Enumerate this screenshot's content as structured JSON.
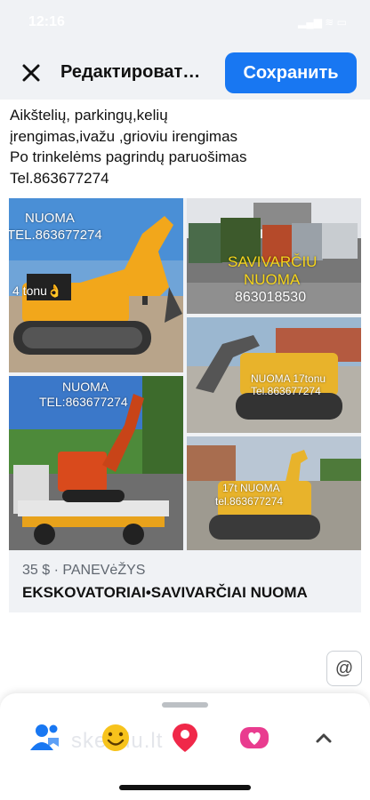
{
  "status_bar": {
    "time": "12:16"
  },
  "header": {
    "title": "Редактироват…",
    "save_label": "Сохранить",
    "close_icon": "close-icon"
  },
  "post": {
    "lines": [
      "Aikštelių, parkingų,kelių",
      "įrengimas,ivažu ,grioviu irengimas",
      "Po trinkelėms pagrindų paruošimas",
      "Tel.863677274"
    ]
  },
  "listing": {
    "photos": [
      {
        "text": [
          "NUOMA",
          "TEL.863677274",
          "4 tonu👌"
        ]
      },
      {
        "text": [
          "SAVIVARČIU",
          "NUOMA",
          "863018530"
        ]
      },
      {
        "text": [
          "NUOMA 17tonu",
          "Tel.863677274"
        ]
      },
      {
        "text": [
          "NUOMA",
          "TEL:863677274"
        ]
      },
      {
        "text": [
          "17t NUOMA",
          "tel.863677274"
        ]
      }
    ],
    "price_location": "35 $ · PANEVėŽYS",
    "title": "EKSKOVATORIAI•SAVIVARČIAI NUOMA"
  },
  "mention_button": "@",
  "toolbar": {
    "watermark": "skelbiu.lt",
    "icons": [
      "tag-people-icon",
      "feeling-emoji-icon",
      "location-pin-icon",
      "gif-badge-icon",
      "expand-chevron-icon"
    ]
  },
  "colors": {
    "accent": "#1877f2",
    "sheet_bg": "#ffffff",
    "card_bg": "#f0f2f5"
  }
}
